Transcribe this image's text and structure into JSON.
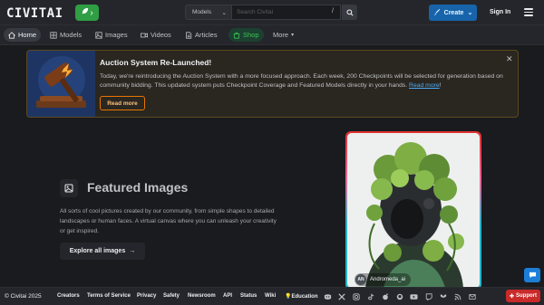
{
  "brand": {
    "logo_text": "CIVIT",
    "logo_accent": "AI",
    "accent": "#1c7ed6"
  },
  "header": {
    "search_type": "Models",
    "search_placeholder": "Search Civitai",
    "search_hotkey": "/",
    "create_label": "Create",
    "signin_label": "Sign In"
  },
  "nav": {
    "items": [
      {
        "label": "Home",
        "icon": "home-icon"
      },
      {
        "label": "Models",
        "icon": "grid-icon"
      },
      {
        "label": "Images",
        "icon": "image-icon"
      },
      {
        "label": "Videos",
        "icon": "video-icon"
      },
      {
        "label": "Articles",
        "icon": "article-icon"
      },
      {
        "label": "Shop",
        "icon": "shop-icon"
      },
      {
        "label": "More",
        "icon": "chevron-down-icon"
      }
    ]
  },
  "banner": {
    "title": "Auction System Re-Launched!",
    "text": "Today, we're reintroducing the Auction System with a more focused approach. Each week, 200 Checkpoints will be selected for generation based on community bidding. This updated system puts Checkpoint Coverage and Featured Models directly in your hands.",
    "link_text": "Read more",
    "link_suffix": "!",
    "button_label": "Read more"
  },
  "featured": {
    "title": "Featured Images",
    "description": "All sorts of cool pictures created by our community, from simple shapes to detailed landscapes or human faces. A virtual canvas where you can unleash your creativity or get inspired.",
    "button_label": "Explore all images",
    "card_author_initials": "AN",
    "card_author_name": "Andromeda_ai"
  },
  "footer": {
    "copyright": "© Civitai 2025",
    "links": [
      "Creators",
      "Terms of Service",
      "Privacy",
      "Safety",
      "Newsroom",
      "API",
      "Status",
      "Wiki",
      "Education"
    ],
    "support_label": "Support"
  }
}
